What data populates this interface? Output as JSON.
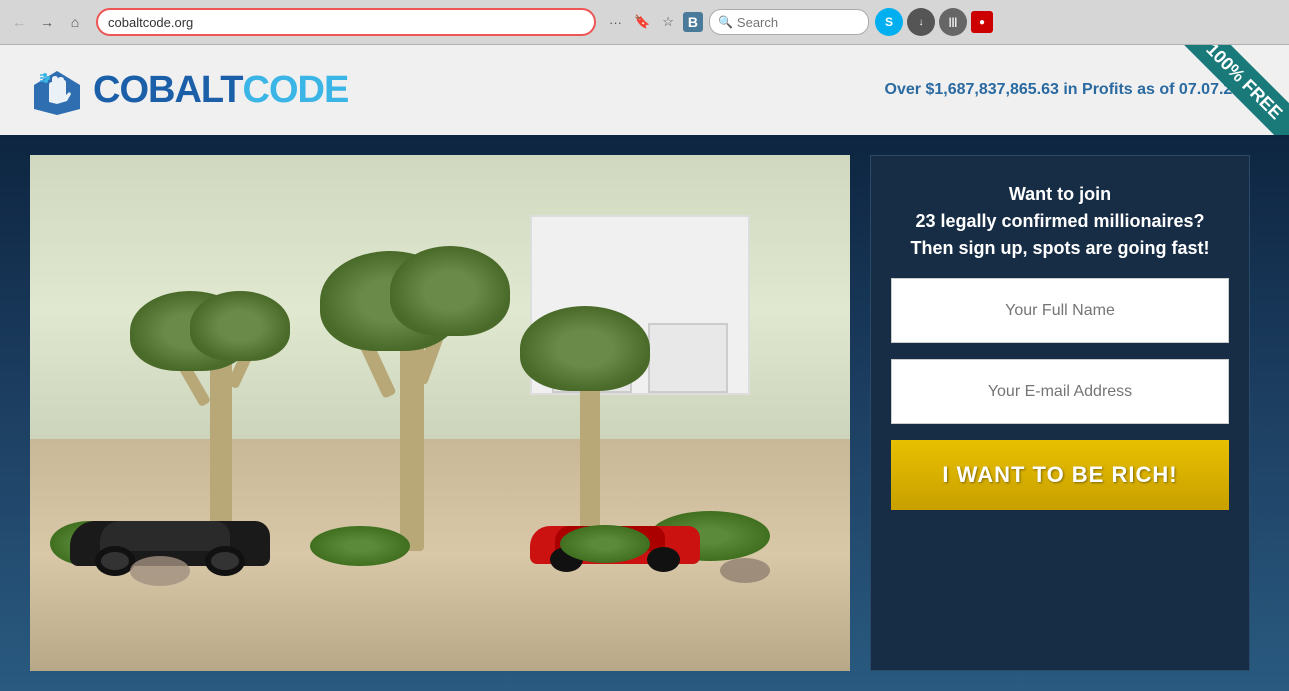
{
  "browser": {
    "url": "cobaltcode.org",
    "search_placeholder": "Search",
    "nav": {
      "back": "←",
      "forward": "→",
      "home": "⌂"
    },
    "tools": {
      "more": "···",
      "bookmark_save": "🔖",
      "star": "☆",
      "reader": "B"
    },
    "icons": {
      "skype": "S",
      "download": "↓",
      "library": "|||",
      "record": "●"
    }
  },
  "site": {
    "logo": {
      "cobalt": "COBALT",
      "code": "CODE"
    },
    "header": {
      "tagline": "Over $1,687,837,865.63 in Profits as of 07.07.2017"
    },
    "ribbon": {
      "text": "100% FREE"
    },
    "signup": {
      "headline": "Want to join\n23 legally confirmed millionaires?\nThen sign up, spots are going fast!",
      "name_placeholder": "Your Full Name",
      "email_placeholder": "Your E-mail Address",
      "button_label": "I WANT TO BE RICH!"
    }
  }
}
